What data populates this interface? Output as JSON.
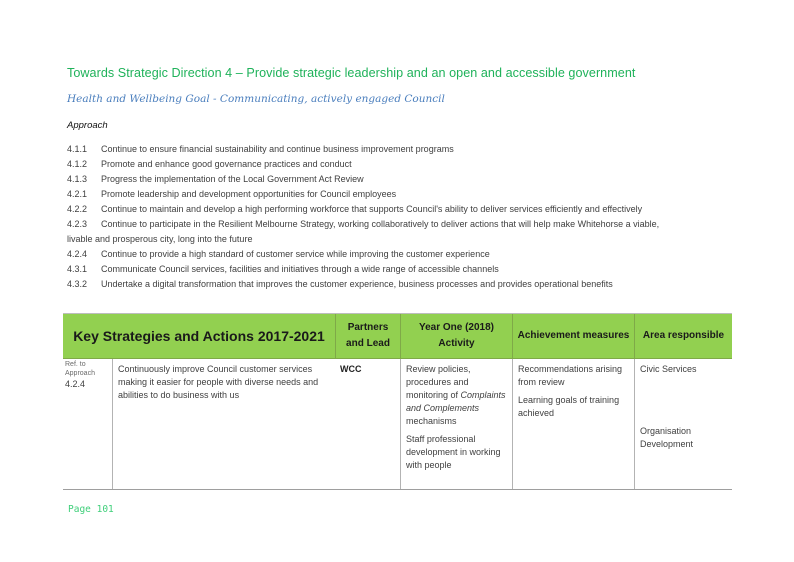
{
  "heading": {
    "title": "Towards Strategic Direction 4 – Provide strategic leadership and an open and accessible government",
    "subtitle": "Health and Wellbeing Goal - Communicating, actively engaged Council",
    "approach_label": "Approach"
  },
  "approach_items": [
    {
      "num": "4.1.1",
      "text": "Continue to ensure financial sustainability and continue business improvement programs"
    },
    {
      "num": "4.1.2",
      "text": "Promote and enhance good governance practices and conduct"
    },
    {
      "num": "4.1.3",
      "text": "Progress the implementation of the Local Government Act Review"
    },
    {
      "num": "4.2.1",
      "text": "Promote leadership and development opportunities for Council employees"
    },
    {
      "num": "4.2.2",
      "text": "Continue to maintain and develop a high performing workforce that supports Council's ability to deliver services efficiently and effectively"
    },
    {
      "num": "4.2.3",
      "text": "Continue to participate in the Resilient Melbourne Strategy, working collaboratively to deliver actions that will help make Whitehorse a viable,",
      "continuation": "livable and prosperous city, long into the future"
    },
    {
      "num": "4.2.4",
      "text": "Continue to provide a high standard of customer service while improving the customer experience"
    },
    {
      "num": "4.3.1",
      "text": "Communicate Council services, facilities and initiatives through a wide range of accessible channels"
    },
    {
      "num": "4.3.2",
      "text": "Undertake a digital transformation that improves the customer experience, business processes and provides operational benefits"
    }
  ],
  "table": {
    "headers": {
      "strategies": "Key Strategies and Actions 2017-2021",
      "partners_line1": "Partners",
      "partners_line2": "and Lead",
      "activity_line1": "Year One (2018)",
      "activity_line2": "Activity",
      "measures": "Achievement measures",
      "area": "Area responsible"
    },
    "colors": {
      "header_bg": "#92d050",
      "title_green": "#1fb25a",
      "subtitle_blue": "#4a7ebd"
    },
    "rows": [
      {
        "ref_label_1": "Ref. to",
        "ref_label_2": "Approach",
        "ref": "4.2.4",
        "action": "Continuously improve Council customer services making it easier for people with diverse needs and abilities to do business with us",
        "partners": "WCC",
        "activity_1_pre": "Review policies, procedures and monitoring of ",
        "activity_1_italic": "Complaints and Complements",
        "activity_1_post": " mechanisms",
        "activity_2": "Staff professional development in working with people",
        "measure_1": "Recommendations arising from review",
        "measure_2": "Learning goals of training achieved",
        "area_1": "Civic Services",
        "area_2": "Organisation Development"
      }
    ]
  },
  "footer": {
    "page": "Page 101"
  }
}
